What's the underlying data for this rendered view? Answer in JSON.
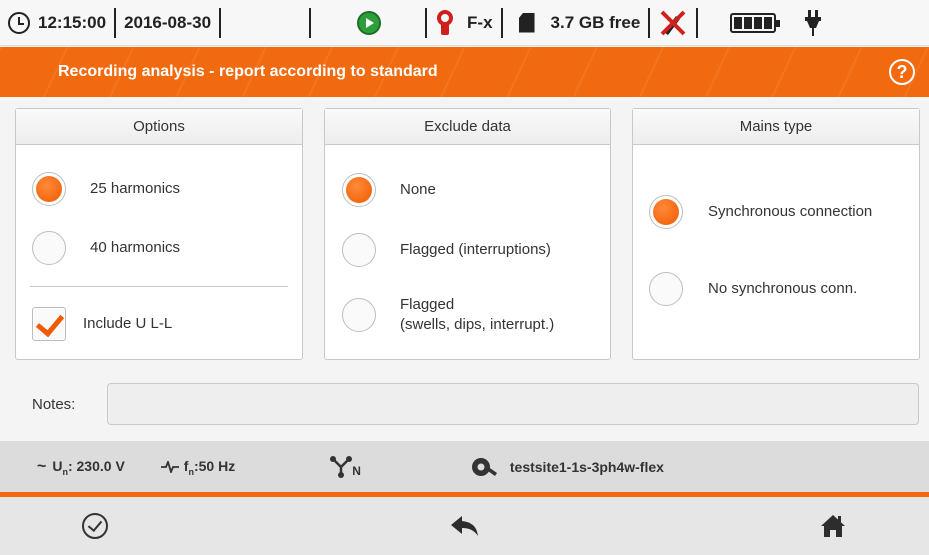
{
  "status": {
    "time": "12:15:00",
    "date": "2016-08-30",
    "clamp": "F-x",
    "storage": "3.7 GB free"
  },
  "header": {
    "title": "Recording analysis - report according to standard",
    "help": "?"
  },
  "options": {
    "title": "Options",
    "items": [
      "25 harmonics",
      "40 harmonics"
    ],
    "selected": "25 harmonics",
    "checkbox_label": "Include U L-L",
    "checkbox_checked": true
  },
  "exclude": {
    "title": "Exclude data",
    "items": [
      "None",
      "Flagged (interruptions)",
      "Flagged",
      "(swells, dips, interrupt.)"
    ],
    "selected": "None"
  },
  "mains": {
    "title": "Mains type",
    "items": [
      "Synchronous connection",
      "No synchronous conn."
    ],
    "selected": "Synchronous connection"
  },
  "notes": {
    "label": "Notes:",
    "value": ""
  },
  "info": {
    "un_symbol": "~",
    "un_label": "U",
    "un_sub": "n",
    "un_value": ": 230.0 V",
    "fn_label": "f",
    "fn_sub": "n",
    "fn_value": ":50 Hz",
    "network_sub": "N",
    "config": "testsite1-1s-3ph4w-flex"
  },
  "colors": {
    "accent": "#f26a10",
    "record": "#2e9e3c"
  },
  "icons": [
    "clock-icon",
    "record-icon",
    "clamp-icon",
    "sd-card-icon",
    "usb-disconnected-icon",
    "battery-icon",
    "plug-icon",
    "help-icon",
    "sine-icon",
    "frequency-icon",
    "network-icon",
    "settings-icon",
    "confirm-icon",
    "back-icon",
    "home-icon"
  ]
}
